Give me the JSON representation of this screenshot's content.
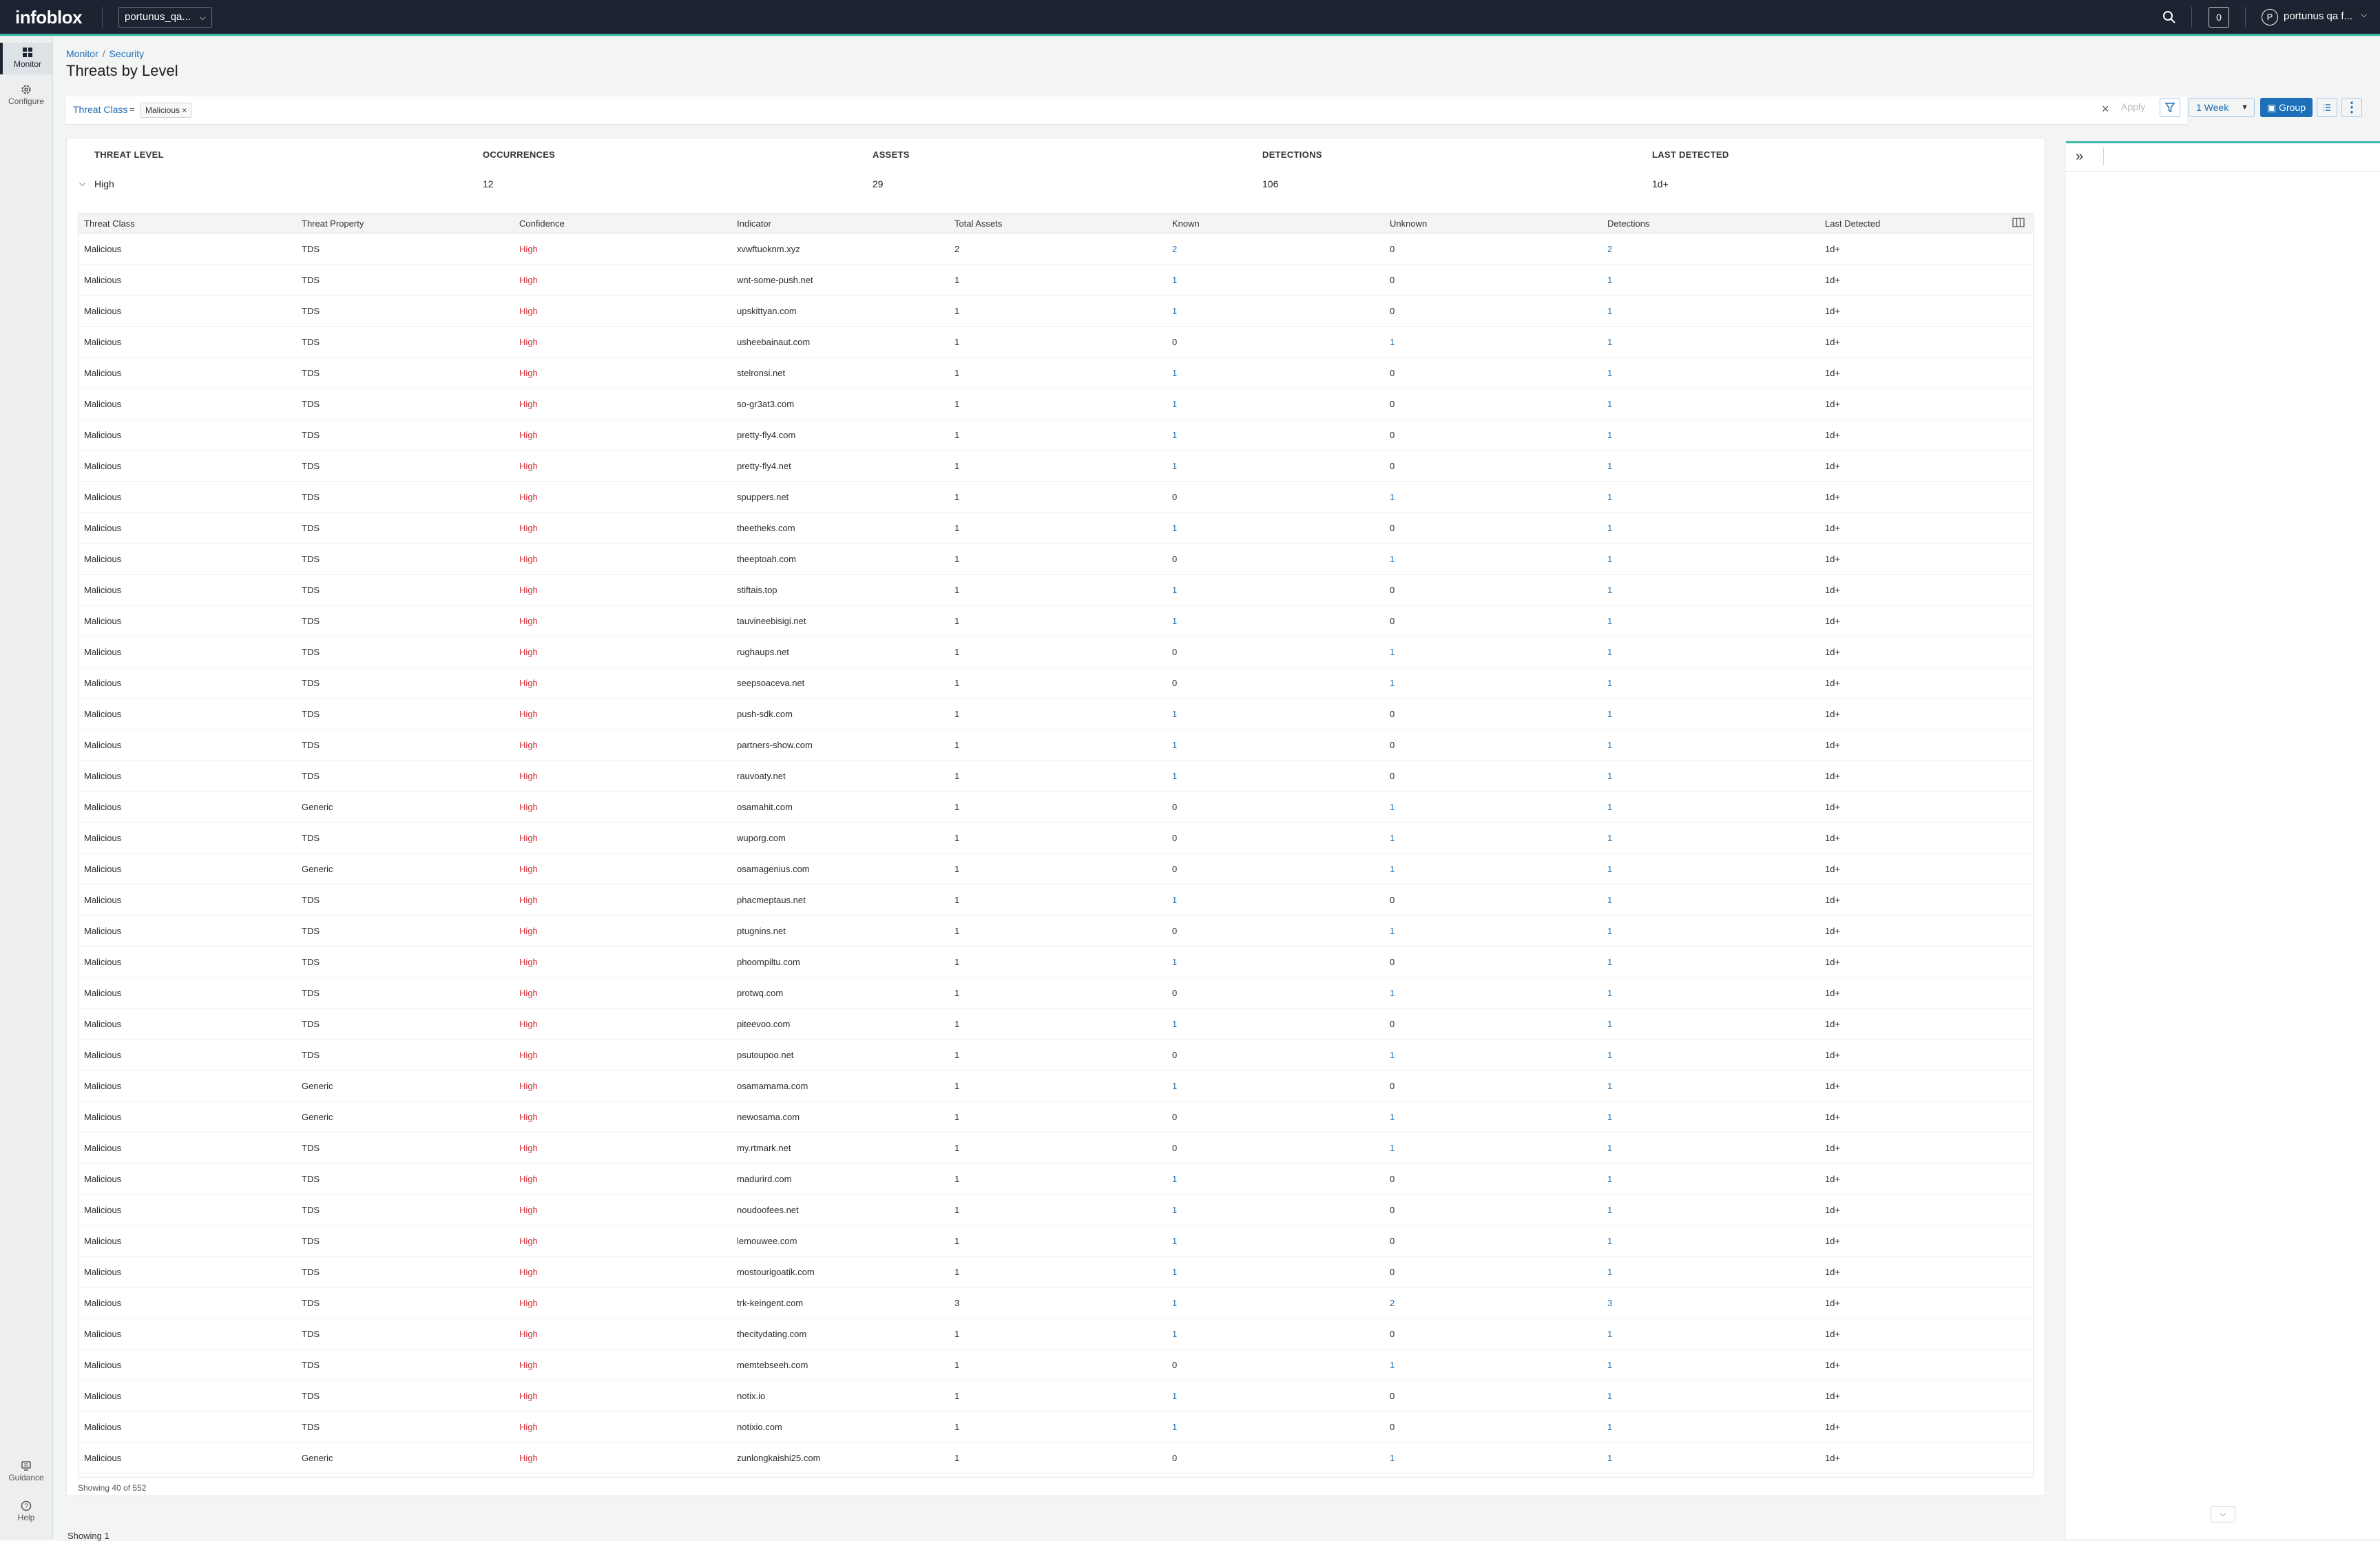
{
  "app": {
    "brand": "infoblox",
    "account": "portunus_qa...",
    "notifications": "0",
    "user_initial": "P",
    "user_name": "portunus qa f..."
  },
  "nav": {
    "items": [
      {
        "label": "Monitor",
        "icon": "grid-icon",
        "active": true
      },
      {
        "label": "Configure",
        "icon": "gear-icon",
        "active": false
      }
    ],
    "bottom": [
      {
        "label": "Guidance",
        "icon": "guidance-icon"
      },
      {
        "label": "Help",
        "icon": "help-icon"
      }
    ]
  },
  "breadcrumb": {
    "root": "Monitor",
    "current": "Security"
  },
  "page_title": "Threats by Level",
  "filter": {
    "field": "Threat Class",
    "operator": "=",
    "value": "Malicious",
    "apply": "Apply",
    "time_range": "1 Week",
    "group_label": "Group"
  },
  "group": {
    "headers": [
      "THREAT LEVEL",
      "OCCURRENCES",
      "ASSETS",
      "DETECTIONS",
      "LAST DETECTED"
    ],
    "row": {
      "level": "High",
      "occurrences": "12",
      "assets": "29",
      "detections": "106",
      "last_detected": "1d+"
    }
  },
  "table": {
    "columns": [
      "Threat Class",
      "Threat Property",
      "Confidence",
      "Indicator",
      "Total Assets",
      "Known",
      "Unknown",
      "Detections",
      "Last Detected"
    ],
    "rows": [
      [
        "Malicious",
        "TDS",
        "High",
        "xvwftuoknm.xyz",
        "2",
        "2",
        "0",
        "2",
        "1d+"
      ],
      [
        "Malicious",
        "TDS",
        "High",
        "wnt-some-push.net",
        "1",
        "1",
        "0",
        "1",
        "1d+"
      ],
      [
        "Malicious",
        "TDS",
        "High",
        "upskittyan.com",
        "1",
        "1",
        "0",
        "1",
        "1d+"
      ],
      [
        "Malicious",
        "TDS",
        "High",
        "usheebainaut.com",
        "1",
        "0",
        "1",
        "1",
        "1d+"
      ],
      [
        "Malicious",
        "TDS",
        "High",
        "stelronsi.net",
        "1",
        "1",
        "0",
        "1",
        "1d+"
      ],
      [
        "Malicious",
        "TDS",
        "High",
        "so-gr3at3.com",
        "1",
        "1",
        "0",
        "1",
        "1d+"
      ],
      [
        "Malicious",
        "TDS",
        "High",
        "pretty-fly4.com",
        "1",
        "1",
        "0",
        "1",
        "1d+"
      ],
      [
        "Malicious",
        "TDS",
        "High",
        "pretty-fly4.net",
        "1",
        "1",
        "0",
        "1",
        "1d+"
      ],
      [
        "Malicious",
        "TDS",
        "High",
        "spuppers.net",
        "1",
        "0",
        "1",
        "1",
        "1d+"
      ],
      [
        "Malicious",
        "TDS",
        "High",
        "theetheks.com",
        "1",
        "1",
        "0",
        "1",
        "1d+"
      ],
      [
        "Malicious",
        "TDS",
        "High",
        "theeptoah.com",
        "1",
        "0",
        "1",
        "1",
        "1d+"
      ],
      [
        "Malicious",
        "TDS",
        "High",
        "stiftais.top",
        "1",
        "1",
        "0",
        "1",
        "1d+"
      ],
      [
        "Malicious",
        "TDS",
        "High",
        "tauvineebisigi.net",
        "1",
        "1",
        "0",
        "1",
        "1d+"
      ],
      [
        "Malicious",
        "TDS",
        "High",
        "rughaups.net",
        "1",
        "0",
        "1",
        "1",
        "1d+"
      ],
      [
        "Malicious",
        "TDS",
        "High",
        "seepsoaceva.net",
        "1",
        "0",
        "1",
        "1",
        "1d+"
      ],
      [
        "Malicious",
        "TDS",
        "High",
        "push-sdk.com",
        "1",
        "1",
        "0",
        "1",
        "1d+"
      ],
      [
        "Malicious",
        "TDS",
        "High",
        "partners-show.com",
        "1",
        "1",
        "0",
        "1",
        "1d+"
      ],
      [
        "Malicious",
        "TDS",
        "High",
        "rauvoaty.net",
        "1",
        "1",
        "0",
        "1",
        "1d+"
      ],
      [
        "Malicious",
        "Generic",
        "High",
        "osamahit.com",
        "1",
        "0",
        "1",
        "1",
        "1d+"
      ],
      [
        "Malicious",
        "TDS",
        "High",
        "wuporg.com",
        "1",
        "0",
        "1",
        "1",
        "1d+"
      ],
      [
        "Malicious",
        "Generic",
        "High",
        "osamagenius.com",
        "1",
        "0",
        "1",
        "1",
        "1d+"
      ],
      [
        "Malicious",
        "TDS",
        "High",
        "phacmeptaus.net",
        "1",
        "1",
        "0",
        "1",
        "1d+"
      ],
      [
        "Malicious",
        "TDS",
        "High",
        "ptugnins.net",
        "1",
        "0",
        "1",
        "1",
        "1d+"
      ],
      [
        "Malicious",
        "TDS",
        "High",
        "phoompiltu.com",
        "1",
        "1",
        "0",
        "1",
        "1d+"
      ],
      [
        "Malicious",
        "TDS",
        "High",
        "protwq.com",
        "1",
        "0",
        "1",
        "1",
        "1d+"
      ],
      [
        "Malicious",
        "TDS",
        "High",
        "piteevoo.com",
        "1",
        "1",
        "0",
        "1",
        "1d+"
      ],
      [
        "Malicious",
        "TDS",
        "High",
        "psutoupoo.net",
        "1",
        "0",
        "1",
        "1",
        "1d+"
      ],
      [
        "Malicious",
        "Generic",
        "High",
        "osamamama.com",
        "1",
        "1",
        "0",
        "1",
        "1d+"
      ],
      [
        "Malicious",
        "Generic",
        "High",
        "newosama.com",
        "1",
        "0",
        "1",
        "1",
        "1d+"
      ],
      [
        "Malicious",
        "TDS",
        "High",
        "my.rtmark.net",
        "1",
        "0",
        "1",
        "1",
        "1d+"
      ],
      [
        "Malicious",
        "TDS",
        "High",
        "madurird.com",
        "1",
        "1",
        "0",
        "1",
        "1d+"
      ],
      [
        "Malicious",
        "TDS",
        "High",
        "noudoofees.net",
        "1",
        "1",
        "0",
        "1",
        "1d+"
      ],
      [
        "Malicious",
        "TDS",
        "High",
        "lemouwee.com",
        "1",
        "1",
        "0",
        "1",
        "1d+"
      ],
      [
        "Malicious",
        "TDS",
        "High",
        "mostourigoatik.com",
        "1",
        "1",
        "0",
        "1",
        "1d+"
      ],
      [
        "Malicious",
        "TDS",
        "High",
        "trk-keingent.com",
        "3",
        "1",
        "2",
        "3",
        "1d+"
      ],
      [
        "Malicious",
        "TDS",
        "High",
        "thecitydating.com",
        "1",
        "1",
        "0",
        "1",
        "1d+"
      ],
      [
        "Malicious",
        "TDS",
        "High",
        "memtebseeh.com",
        "1",
        "0",
        "1",
        "1",
        "1d+"
      ],
      [
        "Malicious",
        "TDS",
        "High",
        "notix.io",
        "1",
        "1",
        "0",
        "1",
        "1d+"
      ],
      [
        "Malicious",
        "TDS",
        "High",
        "notixio.com",
        "1",
        "1",
        "0",
        "1",
        "1d+"
      ],
      [
        "Malicious",
        "Generic",
        "High",
        "zunlongkaishi25.com",
        "1",
        "0",
        "1",
        "1",
        "1d+"
      ]
    ],
    "showing": "Showing 40 of 552"
  },
  "footer": {
    "showing": "Showing 1"
  },
  "colors": {
    "topbar": "#1b2430",
    "accent": "#3fb7a8",
    "link": "#1d6fb8",
    "confidence_high": "#d0343a"
  }
}
